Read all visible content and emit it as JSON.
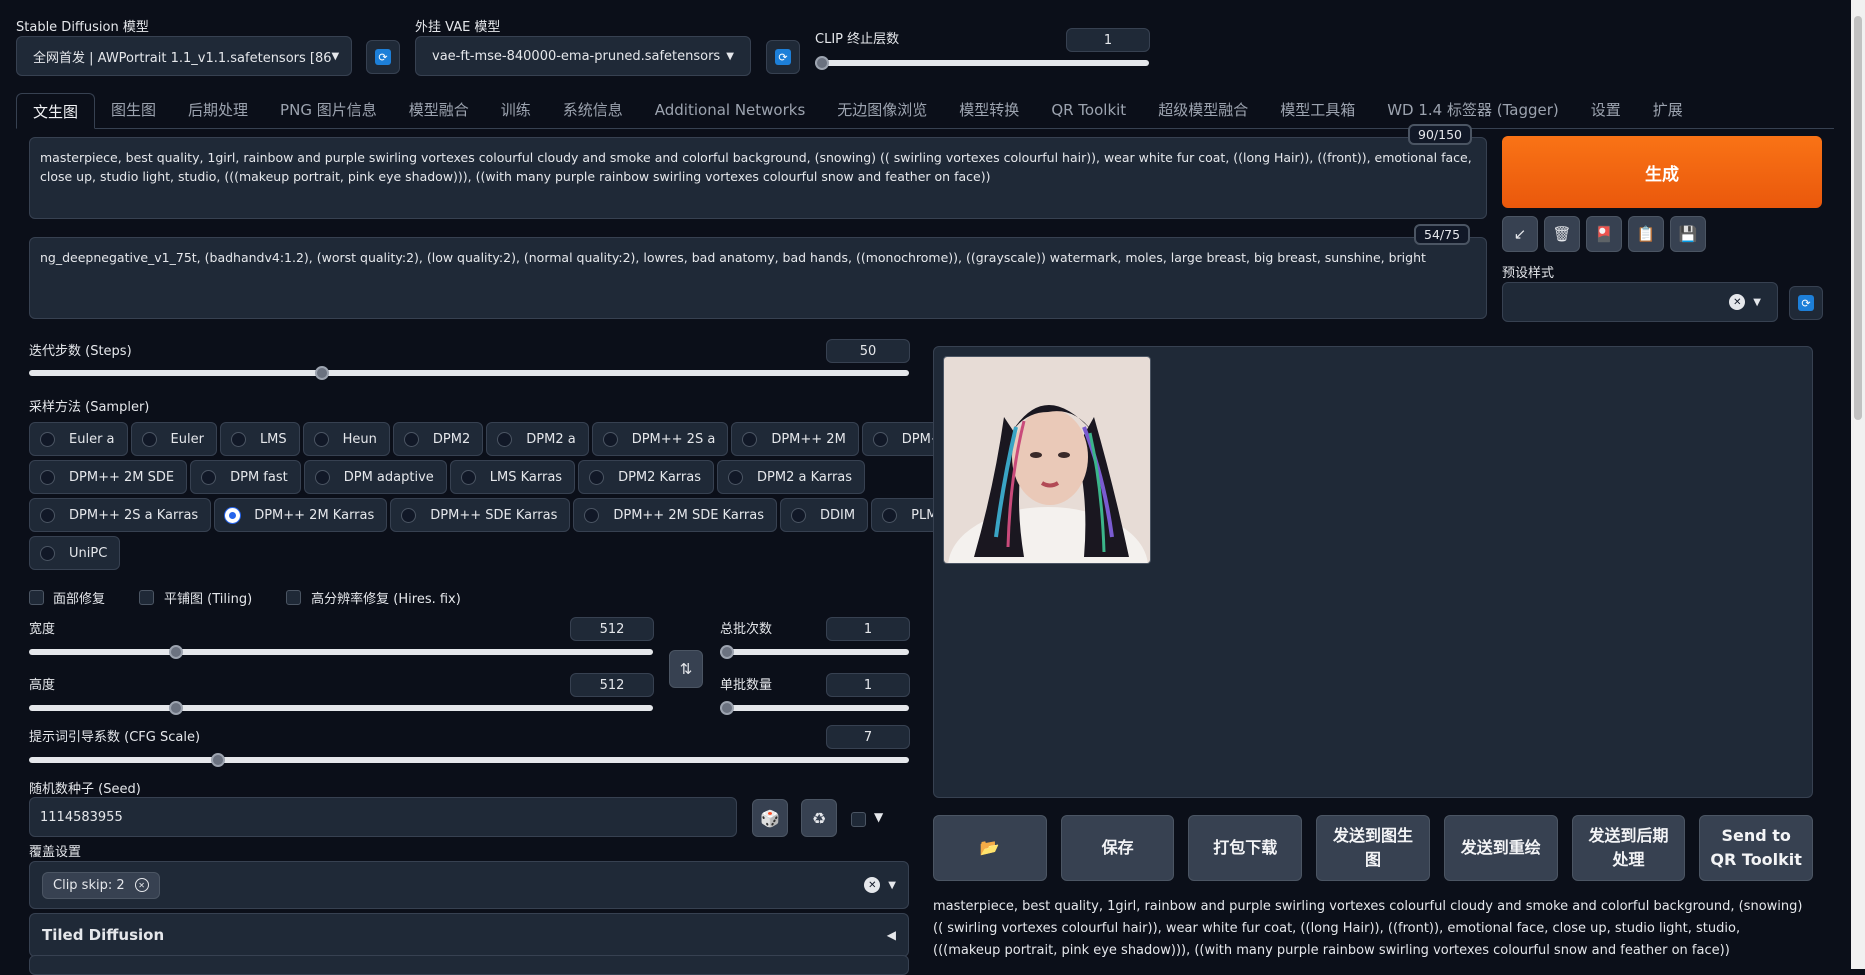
{
  "top": {
    "sd_model_label": "Stable Diffusion 模型",
    "sd_model_value": "全网首发 | AWPortrait 1.1_v1.1.safetensors [86",
    "vae_label": "外挂 VAE 模型",
    "vae_value": "vae-ft-mse-840000-ema-pruned.safetensors",
    "clip_label": "CLIP 终止层数",
    "clip_value": "1"
  },
  "tabs": [
    "文生图",
    "图生图",
    "后期处理",
    "PNG 图片信息",
    "模型融合",
    "训练",
    "系统信息",
    "Additional Networks",
    "无边图像浏览",
    "模型转换",
    "QR Toolkit",
    "超级模型融合",
    "模型工具箱",
    "WD 1.4 标签器 (Tagger)",
    "设置",
    "扩展"
  ],
  "prompt": {
    "positive": "masterpiece, best quality, 1girl, rainbow and purple swirling vortexes colourful cloudy and smoke and colorful background, (snowing) (( swirling vortexes colourful  hair)), wear white fur coat, ((long Hair)), ((front)), emotional face, close up, studio light, studio, (((makeup portrait, pink eye shadow))), ((with many purple rainbow swirling vortexes colourful snow and feather on face))",
    "positive_count": "90/150",
    "negative": "ng_deepnegative_v1_75t, (badhandv4:1.2), (worst quality:2), (low quality:2), (normal quality:2), lowres, bad anatomy, bad hands, ((monochrome)), ((grayscale)) watermark, moles, large breast, big breast, sunshine, bright",
    "negative_count": "54/75"
  },
  "generate_label": "生成",
  "preset_label": "预设样式",
  "steps": {
    "label": "迭代步数 (Steps)",
    "value": "50",
    "fraction": 0.33
  },
  "sampler": {
    "label": "采样方法 (Sampler)",
    "options": [
      "Euler a",
      "Euler",
      "LMS",
      "Heun",
      "DPM2",
      "DPM2 a",
      "DPM++ 2S a",
      "DPM++ 2M",
      "DPM++ SDE",
      "DPM++ 2M SDE",
      "DPM fast",
      "DPM adaptive",
      "LMS Karras",
      "DPM2 Karras",
      "DPM2 a Karras",
      "DPM++ 2S a Karras",
      "DPM++ 2M Karras",
      "DPM++ SDE Karras",
      "DPM++ 2M SDE Karras",
      "DDIM",
      "PLMS",
      "UniPC"
    ],
    "selected": "DPM++ 2M Karras"
  },
  "checks": {
    "face": "面部修复",
    "tiling": "平铺图 (Tiling)",
    "hires": "高分辨率修复 (Hires. fix)"
  },
  "width": {
    "label": "宽度",
    "value": "512",
    "fraction": 0.23
  },
  "height": {
    "label": "高度",
    "value": "512",
    "fraction": 0.23
  },
  "batch_count": {
    "label": "总批次数",
    "value": "1",
    "fraction": 0.0
  },
  "batch_size": {
    "label": "单批数量",
    "value": "1",
    "fraction": 0.0
  },
  "cfg": {
    "label": "提示词引导系数 (CFG Scale)",
    "value": "7",
    "fraction": 0.21
  },
  "seed": {
    "label": "随机数种子 (Seed)",
    "value": "1114583955"
  },
  "override": {
    "label": "覆盖设置",
    "chip": "Clip skip: 2"
  },
  "tiled_label": "Tiled Diffusion",
  "output_buttons": [
    "📂",
    "保存",
    "打包下载",
    "发送到图生图",
    "发送到重绘",
    "发送到后期处理",
    "Send to QR Toolkit"
  ],
  "output_text": "masterpiece, best quality, 1girl, rainbow and purple swirling vortexes colourful cloudy and smoke and colorful background, (snowing) (( swirling vortexes colourful hair)), wear white fur coat, ((long Hair)), ((front)), emotional face, close up, studio light, studio, (((makeup portrait, pink eye shadow))), ((with many purple rainbow swirling vortexes colourful snow and feather on face))"
}
